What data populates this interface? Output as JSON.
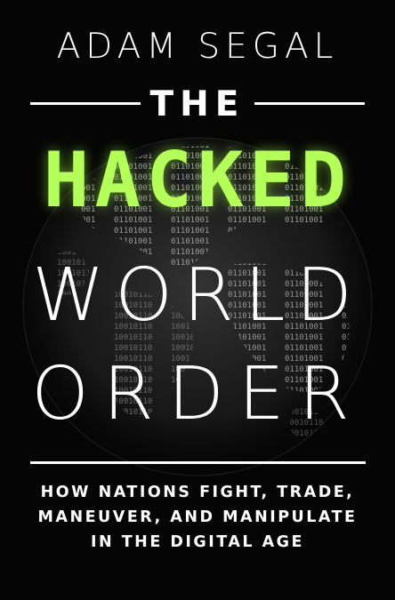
{
  "cover": {
    "author": "ADAM SEGAL",
    "title_the": "THE",
    "title_hacked": "HACKED",
    "title_world": "WORLD",
    "title_order": "ORDER",
    "subtitle_lines": [
      "HOW NATIONS FIGHT, TRADE,",
      "MANEUVER, AND MANIPULATE",
      "IN THE DIGITAL AGE"
    ],
    "colors": {
      "background": "#050505",
      "accent_green": "#b4ff5a",
      "text": "#ffffff",
      "globe_digits": "#8a8a8a"
    },
    "globe_icon": "binary-digits-globe"
  }
}
